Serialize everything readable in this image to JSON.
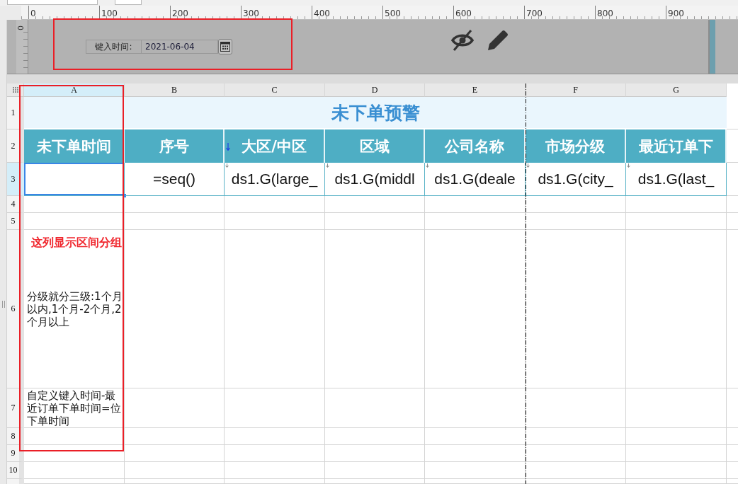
{
  "ruler": {
    "ticks": [
      "0",
      "100",
      "200",
      "300",
      "400",
      "500",
      "600",
      "700",
      "800",
      "900"
    ]
  },
  "vertical_ruler": {
    "ticks": [
      "0"
    ]
  },
  "parameter_panel": {
    "label": "键入时间:",
    "date_field": {
      "value": "2021-06-04"
    }
  },
  "sheet": {
    "columns": [
      {
        "label": "A",
        "selected": true
      },
      {
        "label": "B",
        "selected": false
      },
      {
        "label": "C",
        "selected": false
      },
      {
        "label": "D",
        "selected": false
      },
      {
        "label": "E",
        "selected": false
      },
      {
        "label": "F",
        "selected": false
      },
      {
        "label": "G",
        "selected": false
      }
    ],
    "rows": [
      {
        "number": "1",
        "selected": false,
        "kind": "title",
        "title": "未下单预警"
      },
      {
        "number": "2",
        "selected": false,
        "kind": "header",
        "cells": [
          {
            "text": "未下单时间",
            "sort_marker": false
          },
          {
            "text": "序号",
            "sort_marker": false
          },
          {
            "text": "大区/中区",
            "sort_marker": true
          },
          {
            "text": "区域",
            "sort_marker": false
          },
          {
            "text": "公司名称",
            "sort_marker": false
          },
          {
            "text": "市场分级",
            "sort_marker": false
          },
          {
            "text": "最近订单下",
            "sort_marker": false
          }
        ]
      },
      {
        "number": "3",
        "selected": true,
        "kind": "data",
        "cells": [
          {
            "selected": true,
            "expand_marker": false
          },
          {
            "text": "=seq()",
            "selected": false,
            "expand_marker": false
          },
          {
            "text": "ds1.G(large_",
            "selected": false,
            "expand_marker": true
          },
          {
            "text": "ds1.G(middl",
            "selected": false,
            "expand_marker": true
          },
          {
            "text": "ds1.G(deale",
            "selected": false,
            "expand_marker": true
          },
          {
            "text": "ds1.G(city_",
            "selected": false,
            "expand_marker": true
          },
          {
            "text": "ds1.G(last_",
            "selected": false,
            "expand_marker": true
          }
        ]
      },
      {
        "number": "4",
        "selected": false,
        "kind": "blank"
      },
      {
        "number": "5",
        "selected": false,
        "kind": "blank"
      },
      {
        "number": "6",
        "selected": false,
        "kind": "note",
        "annotation": "这列显示区间分组",
        "text": "分级就分三级:1个月以内,1个月-2个月,2个月以上"
      },
      {
        "number": "7",
        "selected": false,
        "kind": "note",
        "text": "自定义键入时间-最近订单下单时间=位下单时间"
      },
      {
        "number": "8",
        "selected": false,
        "kind": "blank"
      },
      {
        "number": "9",
        "selected": false,
        "kind": "blank"
      },
      {
        "number": "10",
        "selected": false,
        "kind": "blank"
      }
    ]
  }
}
